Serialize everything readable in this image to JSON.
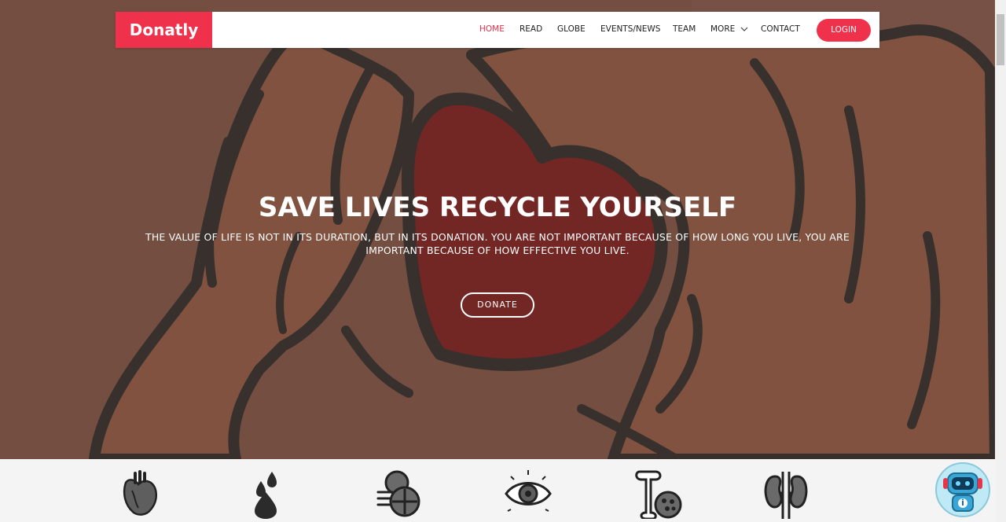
{
  "brand": {
    "name": "Donatly",
    "color": "#f0314b"
  },
  "nav": {
    "items": [
      {
        "label": "HOME",
        "active": true
      },
      {
        "label": "READ"
      },
      {
        "label": "GLOBE"
      },
      {
        "label": "EVENTS/NEWS"
      },
      {
        "label": "TEAM"
      },
      {
        "label": "MORE",
        "dropdown": true
      },
      {
        "label": "CONTACT"
      }
    ],
    "login_label": "LOGIN"
  },
  "hero": {
    "title": "SAVE LIVES RECYCLE YOURSELF",
    "subtitle": "THE VALUE OF LIFE IS NOT IN ITS DURATION, BUT IN ITS DONATION. YOU ARE NOT IMPORTANT BECAUSE OF HOW LONG YOU LIVE, YOU ARE IMPORTANT BECAUSE OF HOW EFFECTIVE YOU LIVE.",
    "cta_label": "DONATE",
    "image": "hands-holding-heart-illustration"
  },
  "organs": [
    {
      "icon": "heart-organ-icon"
    },
    {
      "icon": "blood-drops-icon"
    },
    {
      "icon": "pancreas-icon"
    },
    {
      "icon": "eye-icon"
    },
    {
      "icon": "bone-marrow-icon"
    },
    {
      "icon": "kidneys-icon"
    }
  ],
  "chatbot": {
    "icon": "robot-assistant-icon"
  },
  "colors": {
    "accent": "#f0314b",
    "hero_bg": "#7a5548",
    "heart": "#7a2020"
  }
}
